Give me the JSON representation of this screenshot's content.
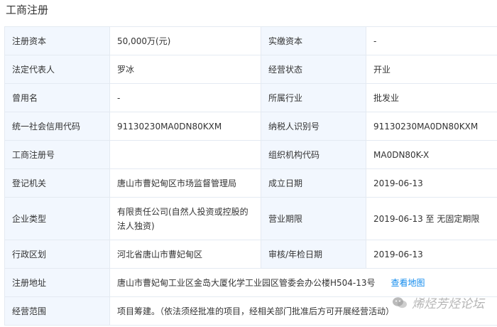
{
  "section": {
    "title": "工商注册"
  },
  "rows": [
    {
      "l1": "注册资本",
      "v1": "50,000万(元)",
      "l2": "实缴资本",
      "v2": "-"
    },
    {
      "l1": "法定代表人",
      "v1": "罗冰",
      "l2": "经营状态",
      "v2": "开业"
    },
    {
      "l1": "曾用名",
      "v1": "-",
      "l2": "所属行业",
      "v2": "批发业"
    },
    {
      "l1": "统一社会信用代码",
      "v1": "91130230MA0DN80KXM",
      "l2": "纳税人识别号",
      "v2": "91130230MA0DN80KXM"
    },
    {
      "l1": "工商注册号",
      "v1": "",
      "l2": "组织机构代码",
      "v2": "MA0DN80K-X"
    },
    {
      "l1": "登记机关",
      "v1": "唐山市曹妃甸区市场监督管理局",
      "l2": "成立日期",
      "v2": "2019-06-13"
    },
    {
      "l1": "企业类型",
      "v1": "有限责任公司(自然人投资或控股的法人独资)",
      "l2": "营业期限",
      "v2": "2019-06-13 至 无固定期限"
    },
    {
      "l1": "行政区划",
      "v1": "河北省唐山市曹妃甸区",
      "l2": "审核/年检日期",
      "v2": "2019-06-13"
    }
  ],
  "address": {
    "label": "注册地址",
    "value": "唐山市曹妃甸工业区金岛大厦化学工业园区管委会办公楼H504-13号",
    "map_link": "查看地图"
  },
  "scope": {
    "label": "经营范围",
    "value": "项目筹建。（依法须经批准的项目，经相关部门批准后方可开展经营活动）"
  },
  "watermark": {
    "text": "烯烃芳烃论坛",
    "icon": "wechat-icon"
  },
  "colors": {
    "label_bg": "#f2f7fe",
    "border": "#e4eaf2",
    "link": "#128bed"
  }
}
